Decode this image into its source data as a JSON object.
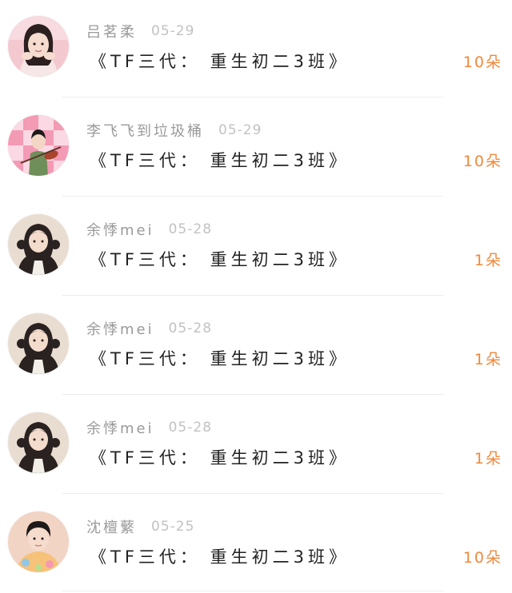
{
  "gift_list": {
    "items": [
      {
        "nickname": "吕茗柔",
        "date": "05-29",
        "title": "《TF三代： 重生初二3班》",
        "count": "10朵",
        "avatar_bg": "#f3c9cf",
        "avatar_accent": "#2b1f1f"
      },
      {
        "nickname": "李飞飞到垃圾桶",
        "date": "05-29",
        "title": "《TF三代： 重生初二3班》",
        "count": "10朵",
        "avatar_bg": "#f39ab5",
        "avatar_accent": "#6f8f5a"
      },
      {
        "nickname": "余悸mei",
        "date": "05-28",
        "title": "《TF三代： 重生初二3班》",
        "count": "1朵",
        "avatar_bg": "#e9ddd1",
        "avatar_accent": "#2a2220"
      },
      {
        "nickname": "余悸mei",
        "date": "05-28",
        "title": "《TF三代： 重生初二3班》",
        "count": "1朵",
        "avatar_bg": "#e9ddd1",
        "avatar_accent": "#2a2220"
      },
      {
        "nickname": "余悸mei",
        "date": "05-28",
        "title": "《TF三代： 重生初二3班》",
        "count": "1朵",
        "avatar_bg": "#e9ddd1",
        "avatar_accent": "#2a2220"
      },
      {
        "nickname": "沈檀蘩",
        "date": "05-25",
        "title": "《TF三代： 重生初二3班》",
        "count": "10朵",
        "avatar_bg": "#f2d4c4",
        "avatar_accent": "#1e1a1a"
      }
    ]
  }
}
